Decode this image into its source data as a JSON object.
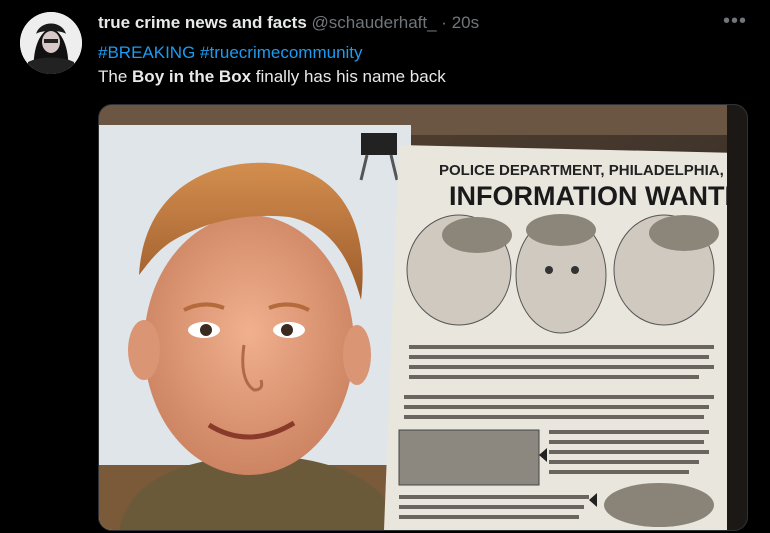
{
  "tweet": {
    "author_name": "true crime news and facts",
    "author_handle": "@schauderhaft_",
    "separator": "·",
    "time": "20s",
    "more_icon": "more-horizontal-icon",
    "hashtags": [
      "#BREAKING",
      "#truecrimecommunity"
    ],
    "text_before": "The ",
    "text_bold": "Boy in the Box",
    "text_after": " finally has his name back"
  },
  "media": {
    "poster_header": "POLICE DEPARTMENT, PHILADELPHIA, PA.",
    "poster_title": "INFORMATION WANTED"
  },
  "colors": {
    "background": "#000000",
    "text": "#e7e9ea",
    "secondary": "#71767b",
    "link": "#1d9bf0"
  }
}
